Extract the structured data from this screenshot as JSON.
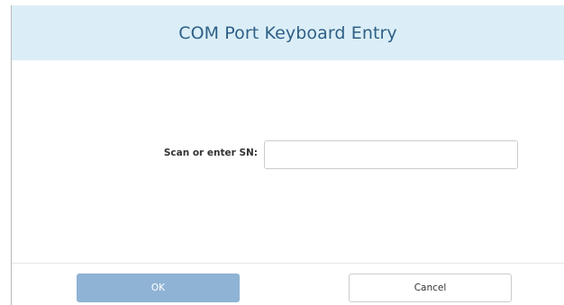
{
  "dialog": {
    "title": "COM Port Keyboard Entry",
    "field": {
      "label": "Scan or enter SN:",
      "value": "",
      "placeholder": ""
    },
    "buttons": {
      "ok_label": "OK",
      "cancel_label": "Cancel"
    }
  },
  "colors": {
    "header_bg": "#dbeef7",
    "title_text": "#2e5f87",
    "ok_button_bg": "#8fb3d4"
  }
}
